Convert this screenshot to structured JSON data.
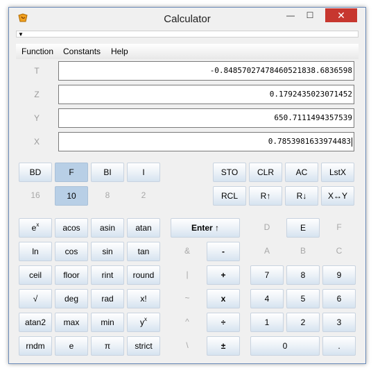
{
  "window": {
    "title": "Calculator",
    "minimize_icon": "minimize-icon",
    "maximize_icon": "maximize-icon",
    "close_icon": "close-icon",
    "close_color": "#c7372f"
  },
  "toolbar": {
    "arrow": "▼"
  },
  "menu": {
    "items": [
      "Function",
      "Constants",
      "Help"
    ]
  },
  "stack": [
    {
      "label": "T",
      "value": "-0.84857027478460521838.6836598"
    },
    {
      "label": "Z",
      "value": "0.1792435023071452"
    },
    {
      "label": "Y",
      "value": "650.7111494357539"
    },
    {
      "label": "X",
      "value": "0.7853981633974483"
    }
  ],
  "modes": {
    "angle": [
      "BD",
      "F",
      "BI",
      "I"
    ],
    "base": [
      "16",
      "10",
      "8",
      "2"
    ],
    "selected": [
      "F",
      "10"
    ]
  },
  "memory": {
    "row1": [
      "STO",
      "CLR",
      "AC",
      "LstX"
    ],
    "row2": [
      "RCL",
      "R↑",
      "R↓",
      "X↔Y"
    ]
  },
  "functions": {
    "row1": [
      "e",
      "acos",
      "asin",
      "atan"
    ],
    "exp_sup": "x",
    "row2": [
      "ln",
      "cos",
      "sin",
      "tan"
    ],
    "row3": [
      "ceil",
      "floor",
      "rint",
      "round"
    ],
    "row4": [
      "√",
      "deg",
      "rad",
      "x!"
    ],
    "row5": [
      "atan2",
      "max",
      "min",
      "y"
    ],
    "pow_sup": "x",
    "row6": [
      "rndm",
      "e",
      "π",
      "strict"
    ]
  },
  "operators": {
    "enter": "Enter ↑",
    "logic": [
      "&",
      "|",
      "~",
      "^",
      "\\"
    ],
    "ops": [
      "-",
      "+",
      "x",
      "÷",
      "±"
    ]
  },
  "keypad": {
    "hex1": [
      "D",
      "E",
      "F"
    ],
    "hex2": [
      "A",
      "B",
      "C"
    ],
    "row1": [
      "7",
      "8",
      "9"
    ],
    "row2": [
      "4",
      "5",
      "6"
    ],
    "row3": [
      "1",
      "2",
      "3"
    ],
    "zero": "0",
    "dot": "."
  },
  "colors": {
    "selected": "#b8cfe6",
    "button_top": "#ffffff",
    "button_bottom": "#d6e3f0"
  }
}
